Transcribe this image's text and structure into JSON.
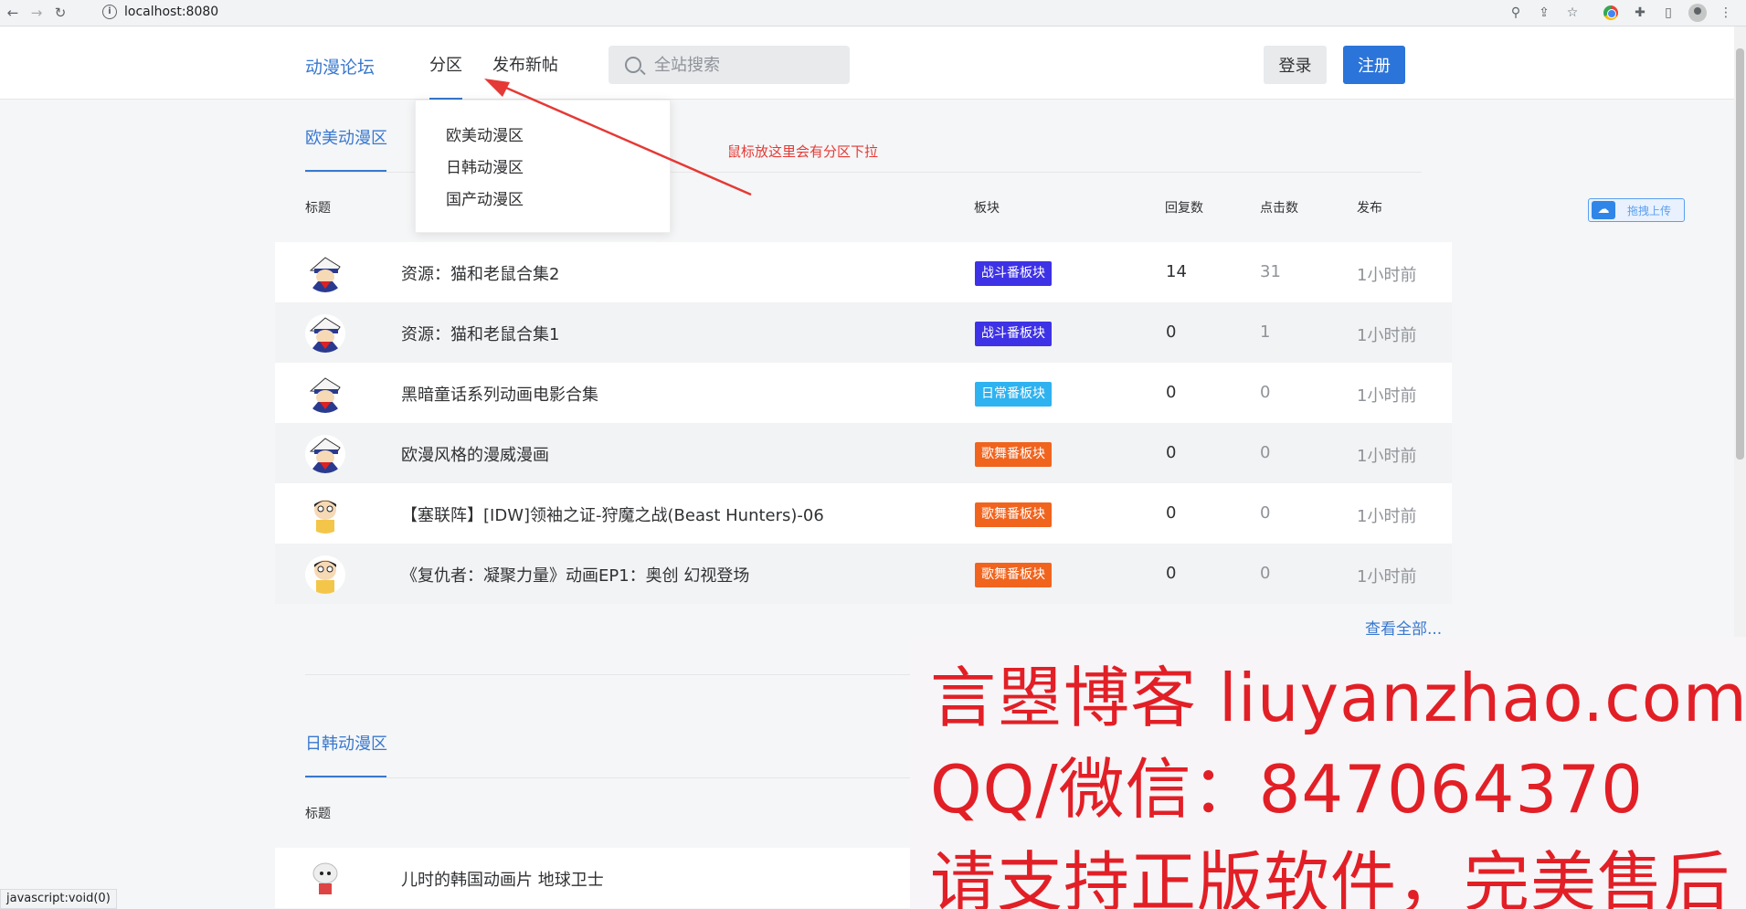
{
  "browser": {
    "url": "localhost:8080",
    "status_text": "javascript:void(0)"
  },
  "header": {
    "logo": "动漫论坛",
    "nav_fenqu": "分区",
    "nav_post": "发布新帖",
    "search_placeholder": "全站搜索",
    "login_label": "登录",
    "register_label": "注册"
  },
  "dropdown": {
    "items": [
      "欧美动漫区",
      "日韩动漫区",
      "国产动漫区"
    ]
  },
  "annotation": "鼠标放这里会有分区下拉",
  "columns": {
    "title": "标题",
    "board": "板块",
    "replies": "回复数",
    "clicks": "点击数",
    "publish": "发布"
  },
  "sections": [
    {
      "title": "欧美动漫区",
      "rows": [
        {
          "title": "资源：猫和老鼠合集2",
          "board": "战斗番板块",
          "replies": "14",
          "clicks": "31",
          "publish": "1小时前",
          "avatar": "kid-avatar"
        },
        {
          "title": "资源：猫和老鼠合集1",
          "board": "战斗番板块",
          "replies": "0",
          "clicks": "1",
          "publish": "1小时前",
          "avatar": "kid-avatar"
        },
        {
          "title": "黑暗童话系列动画电影合集",
          "board": "日常番板块",
          "replies": "0",
          "clicks": "0",
          "publish": "1小时前",
          "avatar": "kid-avatar"
        },
        {
          "title": "欧漫风格的漫威漫画",
          "board": "歌舞番板块",
          "replies": "0",
          "clicks": "0",
          "publish": "1小时前",
          "avatar": "kid-avatar"
        },
        {
          "title": "【塞联阵】[IDW]领袖之证-狩魔之战(Beast Hunters)-06",
          "board": "歌舞番板块",
          "replies": "0",
          "clicks": "0",
          "publish": "1小时前",
          "avatar": "nobita-avatar"
        },
        {
          "title": "《复仇者：凝聚力量》动画EP1：奥创 幻视登场",
          "board": "歌舞番板块",
          "replies": "0",
          "clicks": "0",
          "publish": "1小时前",
          "avatar": "nobita-avatar"
        }
      ],
      "view_all": "查看全部..."
    },
    {
      "title": "日韩动漫区",
      "rows": [
        {
          "title": "儿时的韩国动画片 地球卫士",
          "avatar": "sheep-avatar"
        }
      ]
    }
  ],
  "badge_colors": {
    "战斗番板块": "#3e32e6",
    "日常番板块": "#2fb2f0",
    "歌舞番板块": "#f0641e"
  },
  "upload_label": "拖拽上传",
  "watermark": {
    "line1": "言曌博客 liuyanzhao.com",
    "line2": "QQ/微信：847064370",
    "line3": "请支持正版软件，完美售后"
  }
}
